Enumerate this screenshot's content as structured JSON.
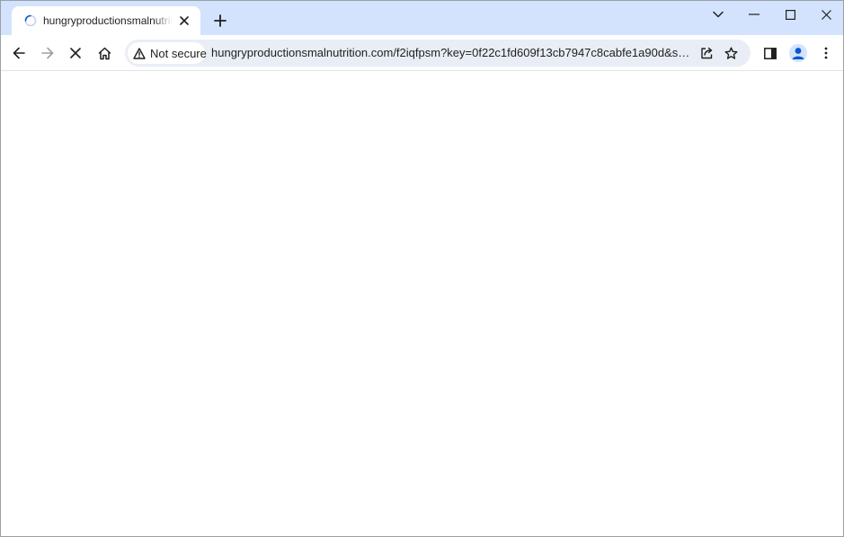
{
  "tab": {
    "title": "hungryproductionsmalnutrition.com"
  },
  "omnibox": {
    "security_label": "Not secure",
    "url": "hungryproductionsmalnutrition.com/f2iqfpsm?key=0f22c1fd609f13cb7947c8cabfe1a90d&submet..."
  },
  "icons": {
    "loading": "loading-spinner-icon",
    "close_tab": "close-icon",
    "new_tab": "plus-icon",
    "tab_search": "chevron-down-icon",
    "minimize": "minimize-icon",
    "maximize": "maximize-icon",
    "close_window": "close-icon",
    "back": "arrow-left-icon",
    "forward": "arrow-right-icon",
    "stop": "stop-x-icon",
    "home": "home-icon",
    "warning": "warning-triangle-icon",
    "share": "share-icon",
    "bookmark": "star-icon",
    "side_panel": "side-panel-icon",
    "profile": "profile-avatar-icon",
    "menu": "kebab-menu-icon"
  },
  "colors": {
    "tabstrip_bg": "#d3e3fd",
    "omnibox_bg": "#e9eef6",
    "accent_blue": "#0b57d0"
  }
}
